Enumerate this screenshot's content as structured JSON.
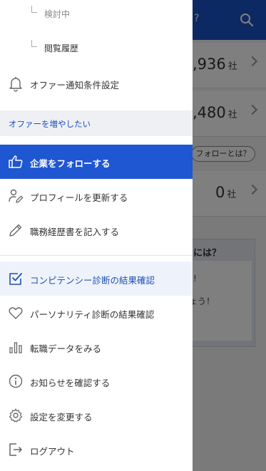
{
  "background": {
    "header_q": "?",
    "rows": [
      {
        "num": ",936",
        "unit": "社"
      },
      {
        "num": ",480",
        "unit": "社"
      },
      {
        "num": "0",
        "unit": "社"
      }
    ],
    "follow_pill": "フォローとは？",
    "box_title": "には？",
    "box_line1": "!",
    "box_line2": "ょう！"
  },
  "drawer": {
    "sub_items": [
      {
        "label": "検討中"
      },
      {
        "label": "閲覧履歴"
      }
    ],
    "offer_settings": "オファー通知条件設定",
    "section_header": "オファーを増やしたい",
    "menu": [
      {
        "label": "企業をフォローする",
        "icon": "thumbs-up-icon"
      },
      {
        "label": "プロフィールを更新する",
        "icon": "person-edit-icon"
      },
      {
        "label": "職務経歴書を記入する",
        "icon": "pencil-icon"
      },
      {
        "label": "コンピテンシー診断の結果確認",
        "icon": "checkbox-icon"
      },
      {
        "label": "パーソナリティ診断の結果確認",
        "icon": "heart-icon"
      },
      {
        "label": "転職データをみる",
        "icon": "bar-chart-icon"
      },
      {
        "label": "お知らせを確認する",
        "icon": "info-icon"
      },
      {
        "label": "設定を変更する",
        "icon": "gear-icon"
      },
      {
        "label": "ログアウト",
        "icon": "logout-icon"
      }
    ]
  },
  "colors": {
    "accent": "#1f56d1",
    "section_bg": "#eef0f4",
    "highlight_bg": "#eef3fb",
    "overlay": "rgba(0,0,0,0.5)"
  }
}
